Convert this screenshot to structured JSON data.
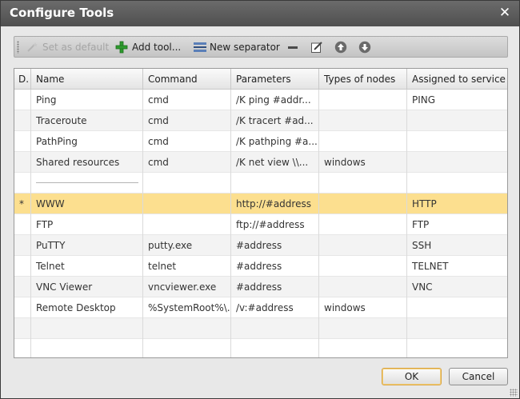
{
  "window": {
    "title": "Configure Tools"
  },
  "toolbar": {
    "set_default": "Set as default",
    "add_tool": "Add tool...",
    "new_separator": "New separator"
  },
  "columns": [
    "D.",
    "Name",
    "Command",
    "Parameters",
    "Types of nodes",
    "Assigned to service"
  ],
  "rows": [
    {
      "d": "",
      "name": "Ping",
      "command": "cmd",
      "parameters": "/K ping #addr...",
      "types": "",
      "service": "PING"
    },
    {
      "d": "",
      "name": "Traceroute",
      "command": "cmd",
      "parameters": "/K tracert #ad...",
      "types": "",
      "service": ""
    },
    {
      "d": "",
      "name": "PathPing",
      "command": "cmd",
      "parameters": "/K pathping #a...",
      "types": "",
      "service": ""
    },
    {
      "d": "",
      "name": "Shared resources",
      "command": "cmd",
      "parameters": "/K net view \\\\...",
      "types": "windows",
      "service": ""
    },
    {
      "d": "",
      "name": "",
      "command": "",
      "parameters": "",
      "types": "",
      "service": ""
    },
    {
      "d": "*",
      "name": "WWW",
      "command": "",
      "parameters": "http://#address",
      "types": "",
      "service": "HTTP"
    },
    {
      "d": "",
      "name": "FTP",
      "command": "",
      "parameters": "ftp://#address",
      "types": "",
      "service": "FTP"
    },
    {
      "d": "",
      "name": "PuTTY",
      "command": "putty.exe",
      "parameters": "#address",
      "types": "",
      "service": "SSH"
    },
    {
      "d": "",
      "name": "Telnet",
      "command": "telnet",
      "parameters": "#address",
      "types": "",
      "service": "TELNET"
    },
    {
      "d": "",
      "name": "VNC Viewer",
      "command": "vncviewer.exe",
      "parameters": "#address",
      "types": "",
      "service": "VNC"
    },
    {
      "d": "",
      "name": "Remote Desktop",
      "command": "%SystemRoot%\\...",
      "parameters": "/v:#address",
      "types": "windows",
      "service": ""
    }
  ],
  "buttons": {
    "ok": "OK",
    "cancel": "Cancel"
  },
  "colors": {
    "selected_row": "#fcdf8f",
    "titlebar": "#5a5a5a"
  }
}
